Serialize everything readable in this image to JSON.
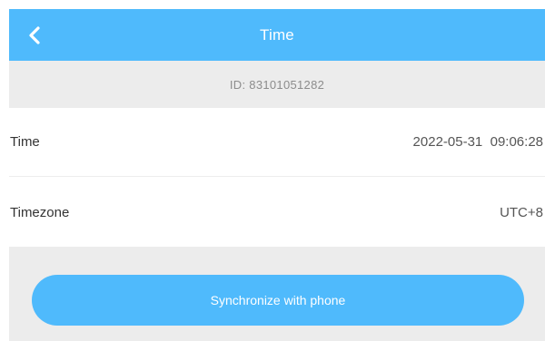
{
  "header": {
    "title": "Time",
    "back_icon": "chevron-left-icon"
  },
  "device": {
    "id_label": "ID:",
    "id_value": "83101051282"
  },
  "settings": {
    "rows": [
      {
        "label": "Time",
        "value": "2022-05-31  09:06:28"
      },
      {
        "label": "Timezone",
        "value": "UTC+8"
      }
    ]
  },
  "actions": {
    "sync_label": "Synchronize with phone"
  },
  "colors": {
    "accent": "#4fbafc",
    "band": "#ececec",
    "text": "#333333",
    "muted": "#8c8c8c"
  }
}
